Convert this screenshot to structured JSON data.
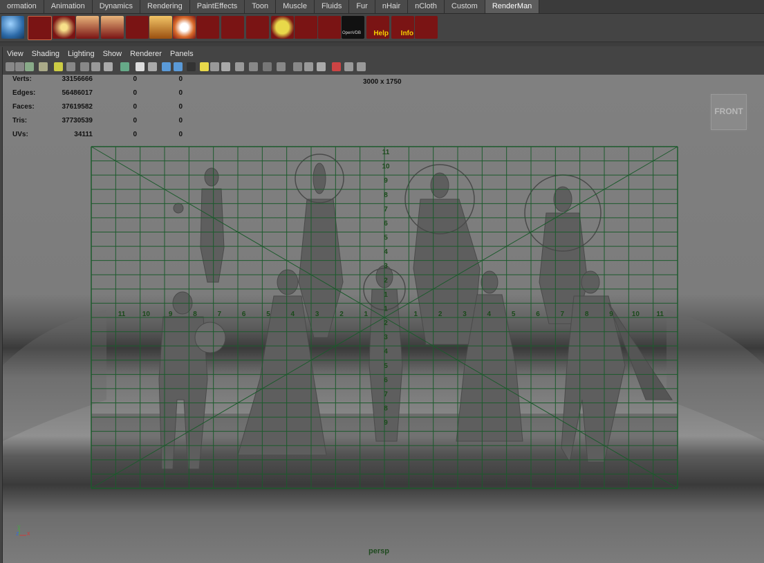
{
  "shelf": {
    "tabs": [
      "ormation",
      "Animation",
      "Dynamics",
      "Rendering",
      "PaintEffects",
      "Toon",
      "Muscle",
      "Fluids",
      "Fur",
      "nHair",
      "nCloth",
      "Custom",
      "RenderMan"
    ],
    "active_tab": "RenderMan",
    "icons": [
      "sphere-shelf-icon",
      "script-editor-icon",
      "light-eye-icon",
      "area-light-icon",
      "area-light-2-icon",
      "ribbon-icon",
      "crate-icon",
      "refresh-icon",
      "folder-icon",
      "search-icon",
      "node-icon",
      "globe-icon",
      "move-icon",
      "cube-icon",
      "openvdb-icon",
      "help-icon",
      "info-icon",
      "puzzle-icon"
    ],
    "help_label": "Help",
    "info_label": "Info",
    "openvdb_label": "OpenVDB"
  },
  "panel_menu": [
    "View",
    "Shading",
    "Lighting",
    "Show",
    "Renderer",
    "Panels"
  ],
  "hud": {
    "rows": [
      {
        "label": "Verts:",
        "total": "33156666",
        "sel1": "0",
        "sel2": "0"
      },
      {
        "label": "Edges:",
        "total": "56486017",
        "sel1": "0",
        "sel2": "0"
      },
      {
        "label": "Faces:",
        "total": "37619582",
        "sel1": "0",
        "sel2": "0"
      },
      {
        "label": "Tris:",
        "total": "37730539",
        "sel1": "0",
        "sel2": "0"
      },
      {
        "label": "UVs:",
        "total": "34111",
        "sel1": "0",
        "sel2": "0"
      }
    ],
    "resolution": "3000 x 1750",
    "camera": "persp",
    "viewcube_face": "FRONT"
  },
  "grid": {
    "vertical_numbers": [
      "11",
      "10",
      "9",
      "8",
      "7",
      "6",
      "5",
      "4",
      "3",
      "2",
      "1",
      "1",
      "2",
      "3",
      "4",
      "5",
      "6",
      "7",
      "8",
      "9"
    ],
    "horizontal_left": [
      "11",
      "10",
      "9",
      "8",
      "7",
      "6",
      "5",
      "4",
      "3",
      "2",
      "1"
    ],
    "horizontal_right": [
      "1",
      "2",
      "3",
      "4",
      "5",
      "6",
      "7",
      "8",
      "9",
      "10",
      "11"
    ],
    "color": "#1c5a2c"
  },
  "axis": {
    "y": "y",
    "z": "z",
    "x": "x"
  }
}
